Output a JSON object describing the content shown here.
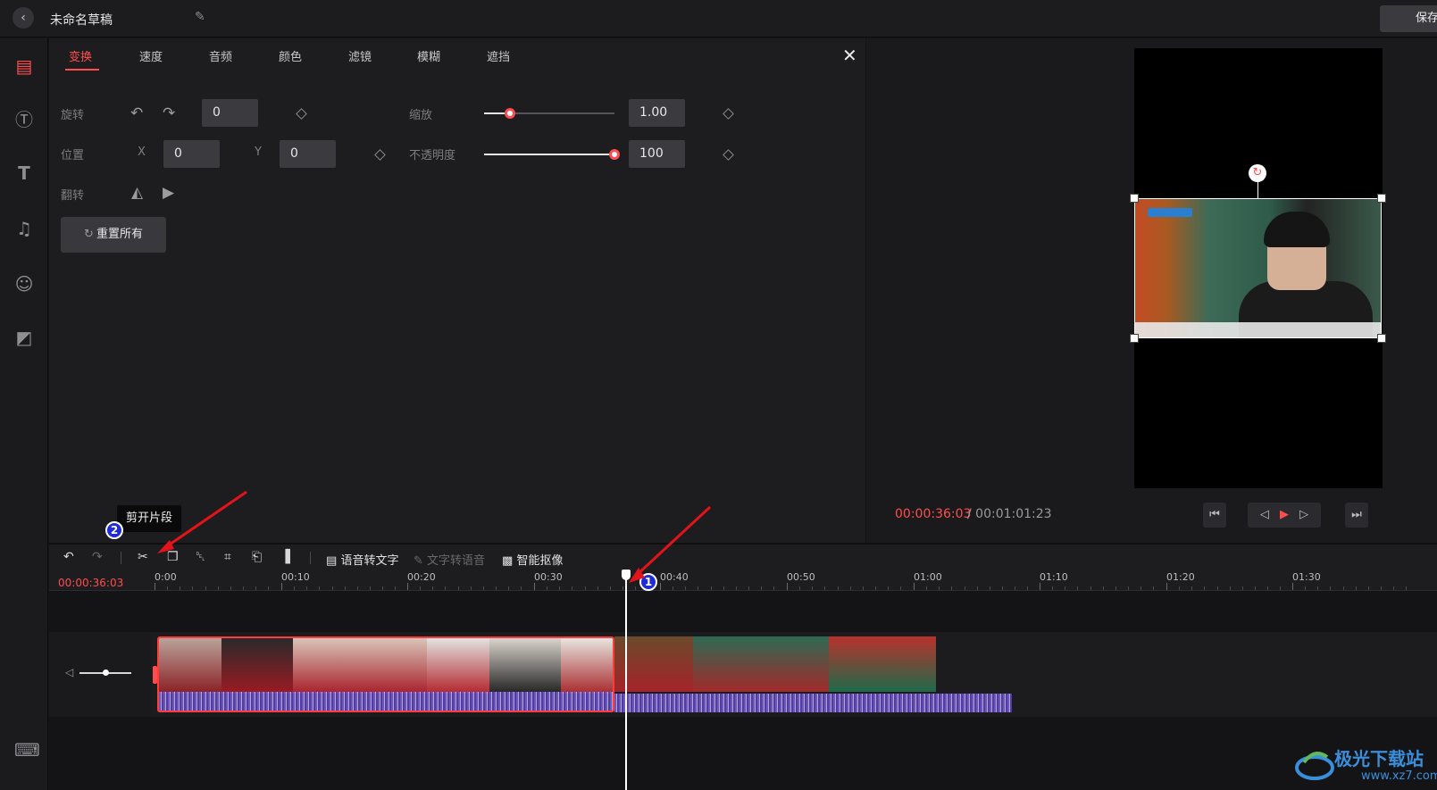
{
  "header": {
    "title": "未命名草稿",
    "save_label": "保存"
  },
  "panel": {
    "tabs": [
      "变换",
      "速度",
      "音频",
      "颜色",
      "滤镜",
      "模糊",
      "遮挡"
    ],
    "active_tab": 0,
    "rotate": {
      "label": "旋转",
      "value": "0"
    },
    "position": {
      "label": "位置",
      "x_label": "X",
      "x_value": "0",
      "y_label": "Y",
      "y_value": "0"
    },
    "flip": {
      "label": "翻转"
    },
    "scale": {
      "label": "缩放",
      "value": "1.00",
      "slider_fraction": 0.2
    },
    "opacity": {
      "label": "不透明度",
      "value": "100",
      "slider_fraction": 1.0
    },
    "reset_label": "重置所有"
  },
  "preview": {
    "current_time": "00:00:36:03",
    "total_time": "/ 00:01:01:23"
  },
  "timeline": {
    "tools": {
      "speech_to_text": "语音转文字",
      "text_to_speech": "文字转语音",
      "smart_cutout": "智能抠像"
    },
    "current_time": "00:00:36:03",
    "ticks": [
      "0:00",
      "00:10",
      "00:20",
      "00:30",
      "00:40",
      "00:50",
      "01:00",
      "01:10",
      "01:20",
      "01:30"
    ],
    "volume_fraction": 0.45
  },
  "tooltip": "剪开片段",
  "annotations": {
    "badge1": "1",
    "badge2": "2"
  },
  "watermark": {
    "text": "极光下载站",
    "url": "www.xz7.com"
  },
  "colors": {
    "accent": "#ff4d4f",
    "badge": "#1f2bd6",
    "background": "#141416"
  }
}
